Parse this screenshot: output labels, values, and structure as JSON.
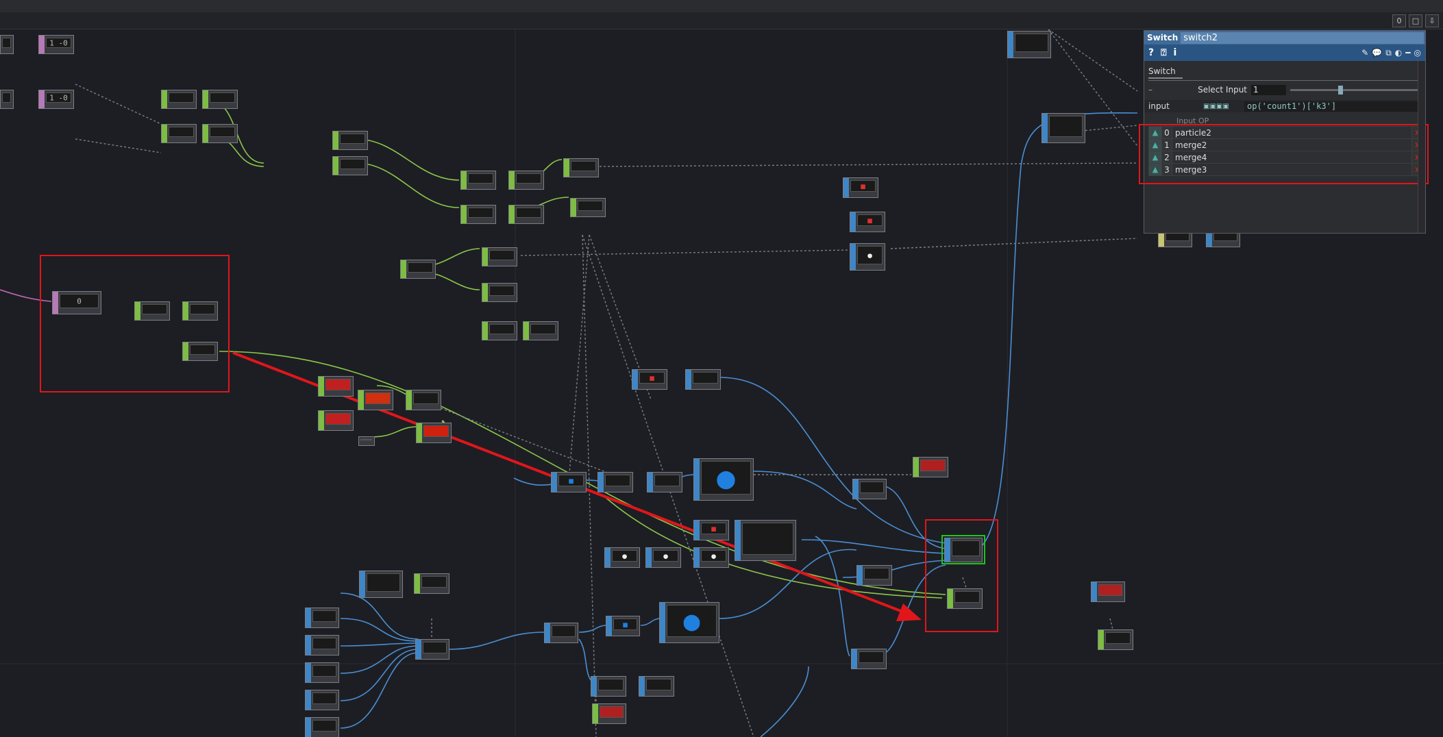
{
  "toolbar": {
    "right_buttons": [
      "0",
      "□",
      "⇩"
    ]
  },
  "params_panel": {
    "op_type": "Switch",
    "op_name": "switch2",
    "icons": [
      "help-icon",
      "python-help-icon",
      "info-icon",
      "edit-icon",
      "comment-icon",
      "clone-icon",
      "python-icon",
      "minimize-icon",
      "target-icon"
    ],
    "page_tab": "Switch",
    "select_input_label": "Select Input",
    "select_input_value": "1",
    "input_label": "input",
    "input_expression": "op('count1')['k3']",
    "input_ops_header": "Input OP",
    "inputs": [
      {
        "index": "0",
        "name": "particle2"
      },
      {
        "index": "1",
        "name": "merge2"
      },
      {
        "index": "2",
        "name": "merge4"
      },
      {
        "index": "3",
        "name": "merge3"
      }
    ]
  },
  "nodes": {
    "dat1": "1 -0",
    "dat2": "1 -0",
    "dat3": "0"
  },
  "colors": {
    "chop": "#7dbd44",
    "top": "#3f86c6",
    "dat": "#b67ab8",
    "wire_chop": "#8cc84b",
    "wire_top": "#4a8fd6",
    "wire_dat": "#c66ab5",
    "annotation": "#e0161b",
    "selection": "#1ec51e"
  }
}
